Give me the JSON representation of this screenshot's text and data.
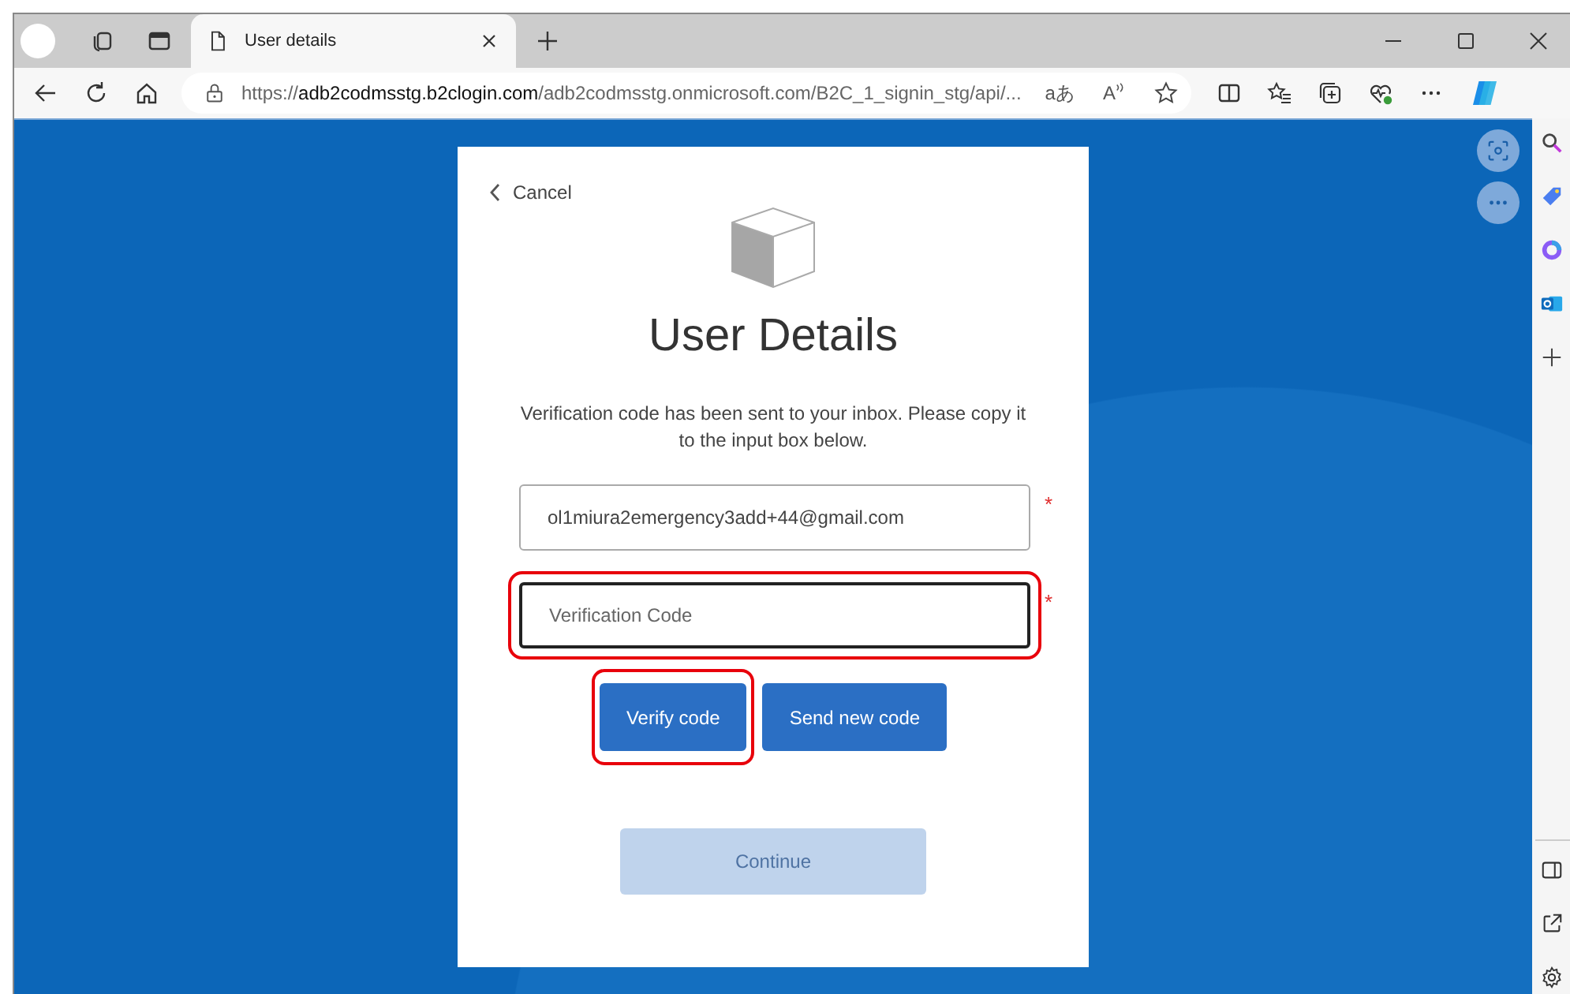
{
  "tab": {
    "title": "User details",
    "selected": true
  },
  "address_bar": {
    "scheme": "https://",
    "host": "adb2codmsstg.b2clogin.com",
    "path": "/adb2codmsstg.onmicrosoft.com/B2C_1_signin_stg/api/...",
    "translate_label": "aあ",
    "read_aloud_label": "A"
  },
  "card": {
    "cancel_link": "Cancel",
    "title": "User Details",
    "message": "Verification code has been sent to your inbox. Please copy it to the input box below.",
    "fields": [
      {
        "value": "ol1miura2emergency3add+44@gmail.com",
        "required_mark": "*",
        "focused": false,
        "highlighted": false
      },
      {
        "placeholder": "Verification Code",
        "required_mark": "*",
        "focused": true,
        "highlighted": true
      }
    ],
    "buttons": [
      {
        "label": "Verify code",
        "highlighted": true
      },
      {
        "label": "Send new code",
        "highlighted": false
      }
    ],
    "continue_button": {
      "label": "Continue",
      "disabled": true
    }
  }
}
